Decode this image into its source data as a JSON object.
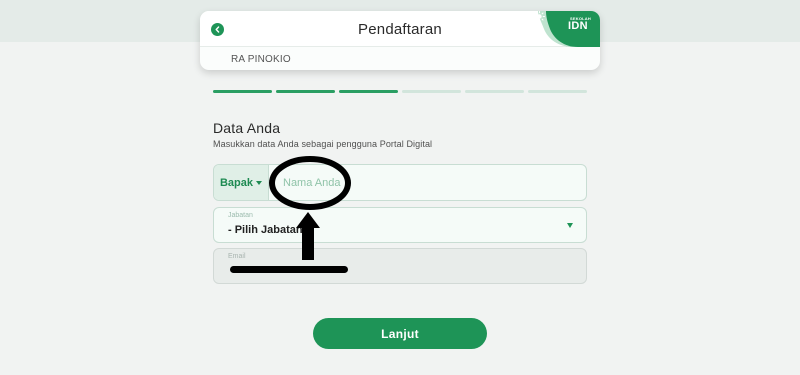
{
  "header": {
    "title": "Pendaftaran",
    "back_icon": "chevron-left-icon",
    "school": "RA PINOKIO",
    "brand": {
      "small_text": "SEKOLAH",
      "name": "IDN",
      "icon": "sun-icon",
      "color": "#1e9457"
    }
  },
  "progress": {
    "steps_total": 6,
    "steps_done": 3,
    "done_color": "#2a9e63",
    "pending_color": "#d2e5dc"
  },
  "section": {
    "title": "Data Anda",
    "subtitle": "Masukkan data Anda sebagai pengguna Portal Digital"
  },
  "form": {
    "salutation": {
      "value": "Bapak"
    },
    "name": {
      "placeholder": "Nama Anda",
      "value": ""
    },
    "jabatan": {
      "label": "Jabatan",
      "value": "- Pilih Jabatan -"
    },
    "email": {
      "label": "Email",
      "value": ""
    }
  },
  "actions": {
    "submit_label": "Lanjut"
  },
  "colors": {
    "accent": "#1e9457",
    "background": "#f1f3f2"
  }
}
